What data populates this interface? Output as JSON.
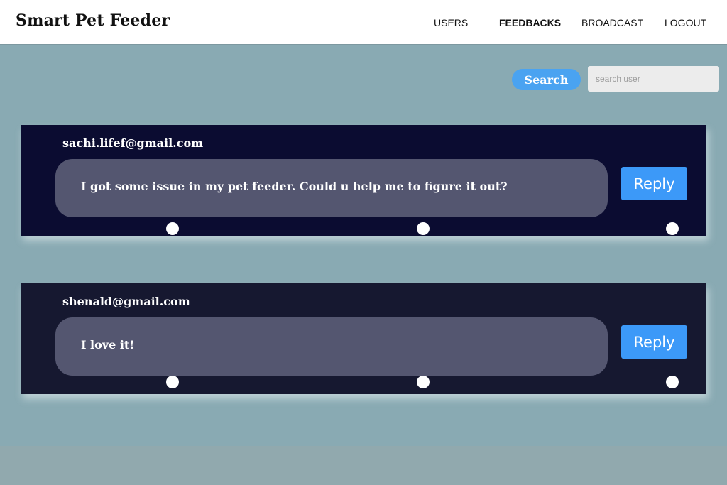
{
  "header": {
    "brand": "Smart Pet Feeder",
    "nav": [
      {
        "label": "USERS",
        "active": false
      },
      {
        "label": "FEEDBACKS",
        "active": true
      },
      {
        "label": "BROADCAST",
        "active": false
      },
      {
        "label": "LOGOUT",
        "active": false
      }
    ]
  },
  "search": {
    "button_label": "Search",
    "placeholder": "search user",
    "value": ""
  },
  "feedbacks": [
    {
      "email": "sachi.lifef@gmail.com",
      "message": "I got some issue in my pet feeder. Could u help me to figure it out?",
      "reply_label": "Reply"
    },
    {
      "email": "shenald@gmail.com",
      "message": "I love it!",
      "reply_label": "Reply"
    }
  ],
  "colors": {
    "page_background": "#89aab3",
    "header_background": "#ffffff",
    "card_background": "#0b0c31",
    "card_background_alt": "#161830",
    "bubble": "#545670",
    "accent": "#3c99f8",
    "search_button": "#4aa3f1"
  }
}
